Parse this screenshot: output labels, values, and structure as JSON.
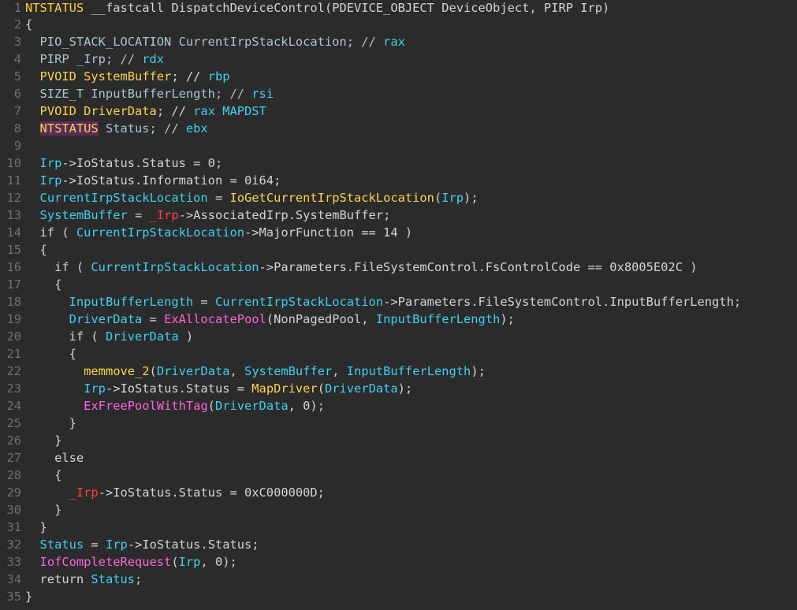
{
  "editor": {
    "lines": [
      {
        "n": "1",
        "toks": [
          [
            "NTSTATUS",
            "ytype"
          ],
          [
            " __fastcall ",
            "plain"
          ],
          [
            "DispatchDeviceControl",
            "plain"
          ],
          [
            "(PDEVICE_OBJECT DeviceObject, PIRP Irp)",
            "plain"
          ]
        ]
      },
      {
        "n": "2",
        "toks": [
          [
            "{",
            "plain"
          ]
        ]
      },
      {
        "n": "3",
        "toks": [
          [
            "  PIO_STACK_LOCATION CurrentIrpStackLocation; // ",
            "type"
          ],
          [
            "rax",
            "reg"
          ]
        ]
      },
      {
        "n": "4",
        "toks": [
          [
            "  PIRP _Irp; // ",
            "type"
          ],
          [
            "rdx",
            "reg"
          ]
        ]
      },
      {
        "n": "5",
        "toks": [
          [
            "  ",
            "plain"
          ],
          [
            "PVOID SystemBuffer",
            "lvar"
          ],
          [
            "; // ",
            "plain"
          ],
          [
            "rbp",
            "reg"
          ]
        ]
      },
      {
        "n": "6",
        "toks": [
          [
            "  SIZE_T InputBufferLength; // ",
            "type"
          ],
          [
            "rsi",
            "reg"
          ]
        ]
      },
      {
        "n": "7",
        "toks": [
          [
            "  ",
            "plain"
          ],
          [
            "PVOID DriverData",
            "lvar"
          ],
          [
            "; // ",
            "plain"
          ],
          [
            "rax MAPDST",
            "reg"
          ]
        ]
      },
      {
        "n": "8",
        "toks": [
          [
            "  ",
            "plain"
          ],
          [
            "NTSTATUS",
            "hl"
          ],
          [
            " Status; // ",
            "type"
          ],
          [
            "ebx",
            "reg"
          ]
        ]
      },
      {
        "n": "9",
        "toks": []
      },
      {
        "n": "10",
        "toks": [
          [
            "  ",
            "plain"
          ],
          [
            "Irp",
            "var"
          ],
          [
            "->IoStatus.Status = 0;",
            "plain"
          ]
        ]
      },
      {
        "n": "11",
        "toks": [
          [
            "  ",
            "plain"
          ],
          [
            "Irp",
            "var"
          ],
          [
            "->IoStatus.Information = 0i64;",
            "plain"
          ]
        ]
      },
      {
        "n": "12",
        "toks": [
          [
            "  ",
            "plain"
          ],
          [
            "CurrentIrpStackLocation",
            "var"
          ],
          [
            " = ",
            "plain"
          ],
          [
            "IoGetCurrentIrpStackLocation",
            "lib"
          ],
          [
            "(",
            "plain"
          ],
          [
            "Irp",
            "var"
          ],
          [
            ");",
            "plain"
          ]
        ]
      },
      {
        "n": "13",
        "toks": [
          [
            "  ",
            "plain"
          ],
          [
            "SystemBuffer",
            "var"
          ],
          [
            " = ",
            "plain"
          ],
          [
            "_Irp",
            "red"
          ],
          [
            "->AssociatedIrp.SystemBuffer;",
            "plain"
          ]
        ]
      },
      {
        "n": "14",
        "toks": [
          [
            "  if ( ",
            "plain"
          ],
          [
            "CurrentIrpStackLocation",
            "var"
          ],
          [
            "->MajorFunction == 14 )",
            "plain"
          ]
        ]
      },
      {
        "n": "15",
        "toks": [
          [
            "  {",
            "plain"
          ]
        ]
      },
      {
        "n": "16",
        "toks": [
          [
            "    if ( ",
            "plain"
          ],
          [
            "CurrentIrpStackLocation",
            "var"
          ],
          [
            "->Parameters.FileSystemControl.FsControlCode == 0x8005E02C )",
            "plain"
          ]
        ]
      },
      {
        "n": "17",
        "toks": [
          [
            "    {",
            "plain"
          ]
        ]
      },
      {
        "n": "18",
        "toks": [
          [
            "      ",
            "plain"
          ],
          [
            "InputBufferLength",
            "var"
          ],
          [
            " = ",
            "plain"
          ],
          [
            "CurrentIrpStackLocation",
            "var"
          ],
          [
            "->Parameters.FileSystemControl.InputBufferLength;",
            "plain"
          ]
        ]
      },
      {
        "n": "19",
        "toks": [
          [
            "      ",
            "plain"
          ],
          [
            "DriverData",
            "var"
          ],
          [
            " = ",
            "plain"
          ],
          [
            "ExAllocatePool",
            "fn"
          ],
          [
            "(NonPagedPool, ",
            "plain"
          ],
          [
            "InputBufferLength",
            "var"
          ],
          [
            ");",
            "plain"
          ]
        ]
      },
      {
        "n": "20",
        "toks": [
          [
            "      if ( ",
            "plain"
          ],
          [
            "DriverData",
            "var"
          ],
          [
            " )",
            "plain"
          ]
        ]
      },
      {
        "n": "21",
        "toks": [
          [
            "      {",
            "plain"
          ]
        ]
      },
      {
        "n": "22",
        "toks": [
          [
            "        ",
            "plain"
          ],
          [
            "memmove_2",
            "glob"
          ],
          [
            "(",
            "plain"
          ],
          [
            "DriverData",
            "var"
          ],
          [
            ", ",
            "plain"
          ],
          [
            "SystemBuffer",
            "var"
          ],
          [
            ", ",
            "plain"
          ],
          [
            "InputBufferLength",
            "var"
          ],
          [
            ");",
            "plain"
          ]
        ]
      },
      {
        "n": "23",
        "toks": [
          [
            "        ",
            "plain"
          ],
          [
            "Irp",
            "var"
          ],
          [
            "->IoStatus.Status = ",
            "plain"
          ],
          [
            "MapDriver",
            "lib"
          ],
          [
            "(",
            "plain"
          ],
          [
            "DriverData",
            "var"
          ],
          [
            ");",
            "plain"
          ]
        ]
      },
      {
        "n": "24",
        "toks": [
          [
            "        ",
            "plain"
          ],
          [
            "ExFreePoolWithTag",
            "fn"
          ],
          [
            "(",
            "plain"
          ],
          [
            "DriverData",
            "var"
          ],
          [
            ", 0);",
            "plain"
          ]
        ]
      },
      {
        "n": "25",
        "toks": [
          [
            "      }",
            "plain"
          ]
        ]
      },
      {
        "n": "26",
        "toks": [
          [
            "    }",
            "plain"
          ]
        ]
      },
      {
        "n": "27",
        "toks": [
          [
            "    else",
            "plain"
          ]
        ]
      },
      {
        "n": "28",
        "toks": [
          [
            "    {",
            "plain"
          ]
        ]
      },
      {
        "n": "29",
        "toks": [
          [
            "      ",
            "plain"
          ],
          [
            "_Irp",
            "red"
          ],
          [
            "->IoStatus.Status = 0xC000000D;",
            "plain"
          ]
        ]
      },
      {
        "n": "30",
        "toks": [
          [
            "    }",
            "plain"
          ]
        ]
      },
      {
        "n": "31",
        "toks": [
          [
            "  }",
            "plain"
          ]
        ]
      },
      {
        "n": "32",
        "toks": [
          [
            "  ",
            "plain"
          ],
          [
            "Status",
            "var"
          ],
          [
            " = ",
            "plain"
          ],
          [
            "Irp",
            "var"
          ],
          [
            "->IoStatus.Status;",
            "plain"
          ]
        ]
      },
      {
        "n": "33",
        "toks": [
          [
            "  ",
            "plain"
          ],
          [
            "IofCompleteRequest",
            "fn"
          ],
          [
            "(",
            "plain"
          ],
          [
            "Irp",
            "var"
          ],
          [
            ", 0);",
            "plain"
          ]
        ]
      },
      {
        "n": "34",
        "toks": [
          [
            "  return ",
            "plain"
          ],
          [
            "Status",
            "var"
          ],
          [
            ";",
            "plain"
          ]
        ]
      },
      {
        "n": "35",
        "toks": [
          [
            "}",
            "plain"
          ]
        ]
      }
    ]
  },
  "colors": {
    "background": "#2b2b2b",
    "line_number": "#6f6f6f",
    "plain_text": "#d4d4d4",
    "variable": "#3fd0f0",
    "function": "#ff64d8",
    "library_call": "#ffd24a",
    "red_var": "#ff4040",
    "highlight": "#5a2b5a"
  }
}
